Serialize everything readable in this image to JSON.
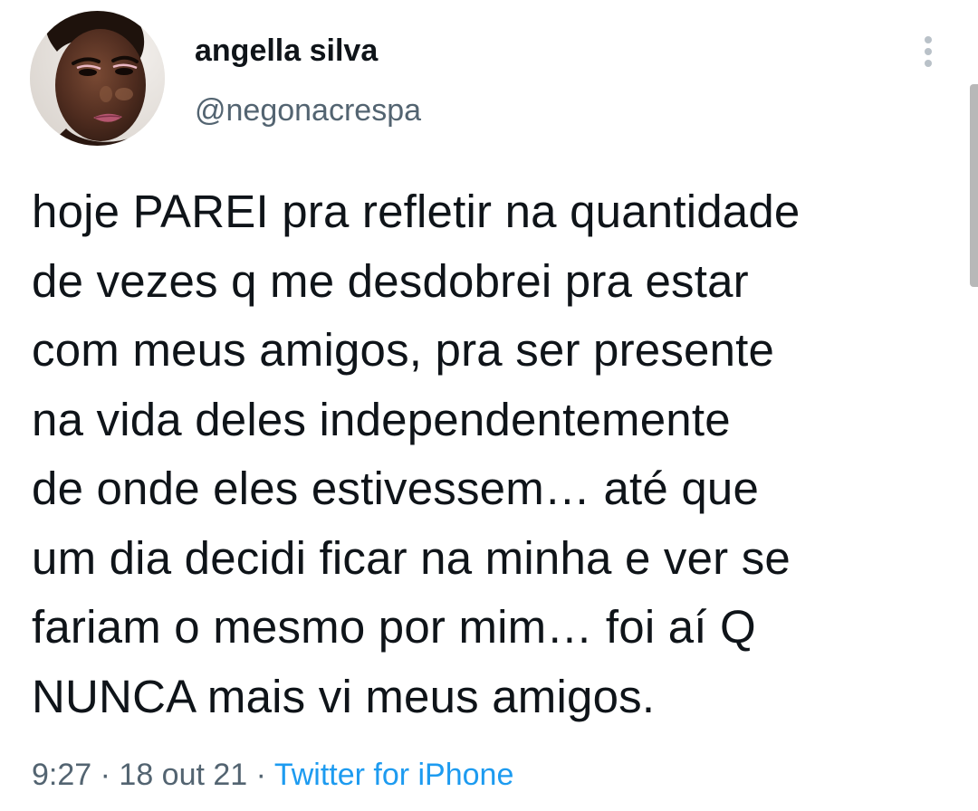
{
  "tweet": {
    "author": {
      "display_name": "angella silva",
      "handle": "@negonacrespa"
    },
    "text": "hoje PAREI pra refletir na quantidade\nde vezes q me desdobrei pra estar\ncom meus amigos, pra ser presente\nna vida deles independentemente\nde onde eles estivessem… até que\num dia decidi ficar na minha e ver se\nfariam o mesmo por mim… foi aí Q\nNUNCA mais vi meus amigos.",
    "time": "9:27",
    "separator": " · ",
    "date": "18 out 21",
    "source": "Twitter for iPhone"
  },
  "icons": {
    "more": "more-vertical-icon",
    "avatar": "profile-photo"
  },
  "colors": {
    "text_primary": "#0f1419",
    "text_secondary": "#536471",
    "link": "#1d9bf0",
    "background": "#ffffff"
  }
}
